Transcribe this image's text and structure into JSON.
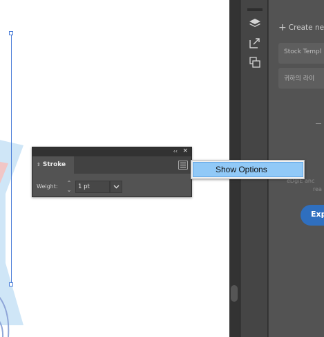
{
  "stroke_panel": {
    "title": "Stroke",
    "collapse_glyph": "‹‹",
    "close_glyph": "×",
    "weight_label": "Weight:",
    "weight_value": "1 pt",
    "tab_arrows": "⇕"
  },
  "flyout_menu": {
    "items": [
      {
        "label": "Show Options"
      }
    ]
  },
  "libraries_panel": {
    "create_new": "Create ne",
    "plus_glyph": "+",
    "stock_button": "Stock Templ",
    "korean_button": "귀하의 라이",
    "faint_line1": "eDgiE anc",
    "faint_line2": "rea",
    "explore_button": "Exp"
  },
  "colors": {
    "accent": "#4a7dd8",
    "highlight": "#91c9f7",
    "panel_bg": "#535353",
    "explore_blue": "#2f6fbf"
  },
  "icons": [
    "layers-icon",
    "export-icon",
    "arrange-icon",
    "chevron-down-icon",
    "panel-menu-icon"
  ]
}
